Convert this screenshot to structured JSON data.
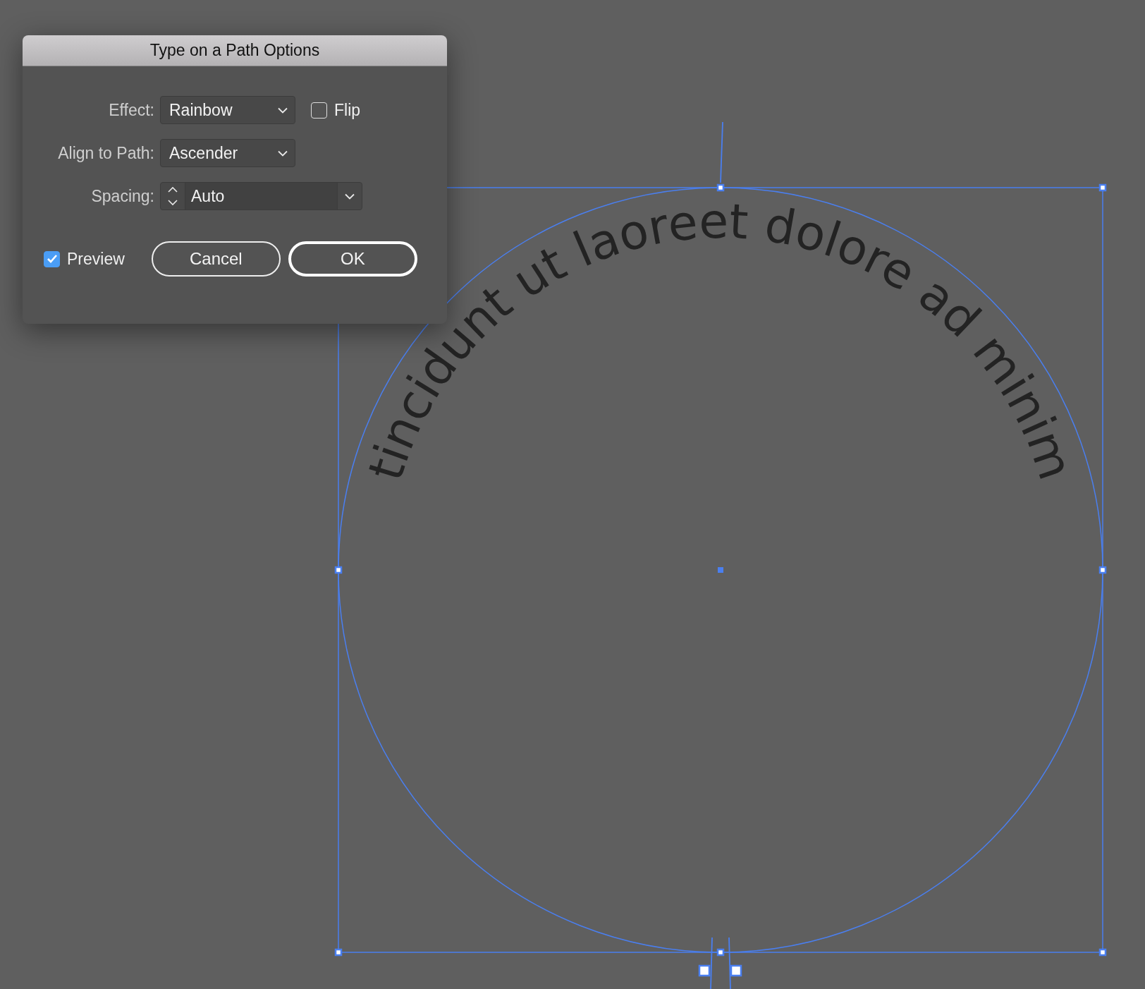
{
  "dialog": {
    "title": "Type on a Path Options",
    "effect": {
      "label": "Effect:",
      "value": "Rainbow"
    },
    "flip": {
      "label": "Flip",
      "checked": false
    },
    "align_to_path": {
      "label": "Align to Path:",
      "value": "Ascender"
    },
    "spacing": {
      "label": "Spacing:",
      "value": "Auto"
    },
    "preview": {
      "label": "Preview",
      "checked": true
    },
    "buttons": [
      {
        "label": "Cancel",
        "default": false
      },
      {
        "label": "OK",
        "default": true
      }
    ]
  },
  "canvas": {
    "path_text": "tincidunt ut laoreet dolore ad minim"
  }
}
